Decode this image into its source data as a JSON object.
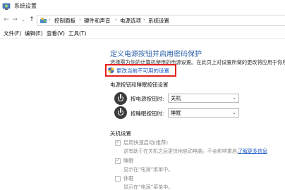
{
  "window": {
    "title": "系统设置"
  },
  "nav": {
    "breadcrumbs": [
      "控制面板",
      "硬件和声音",
      "电源选项",
      "系统设置"
    ]
  },
  "menu": [
    "文件(F)",
    "编辑(E)",
    "查看(V)",
    "工具(T)"
  ],
  "page": {
    "heading": "定义电源按钮并启用密码保护",
    "description": "选择需为你的计算机使用的电源设置。在此页上对设置所做的更改将应用于你所有的",
    "change_link": "更改当前不可用的设置"
  },
  "power_buttons": {
    "section_title": "电源按钮和睡眠按钮设置",
    "rows": [
      {
        "label": "按电源按钮时:",
        "value": "关机"
      },
      {
        "label": "按睡眠按钮时:",
        "value": "睡眠"
      }
    ]
  },
  "shutdown": {
    "section_title": "关机设置",
    "options": [
      {
        "label": "启用快速启动(推荐)",
        "checked": true,
        "desc": "这有助于在关机之后更快地启动电脑。不会影响重启。",
        "link": "了解更多信息"
      },
      {
        "label": "睡眠",
        "checked": true,
        "desc": "显示在“电源”菜单中。"
      },
      {
        "label": "休眠",
        "checked": false,
        "desc": "显示在“电源”菜单中。"
      }
    ]
  }
}
